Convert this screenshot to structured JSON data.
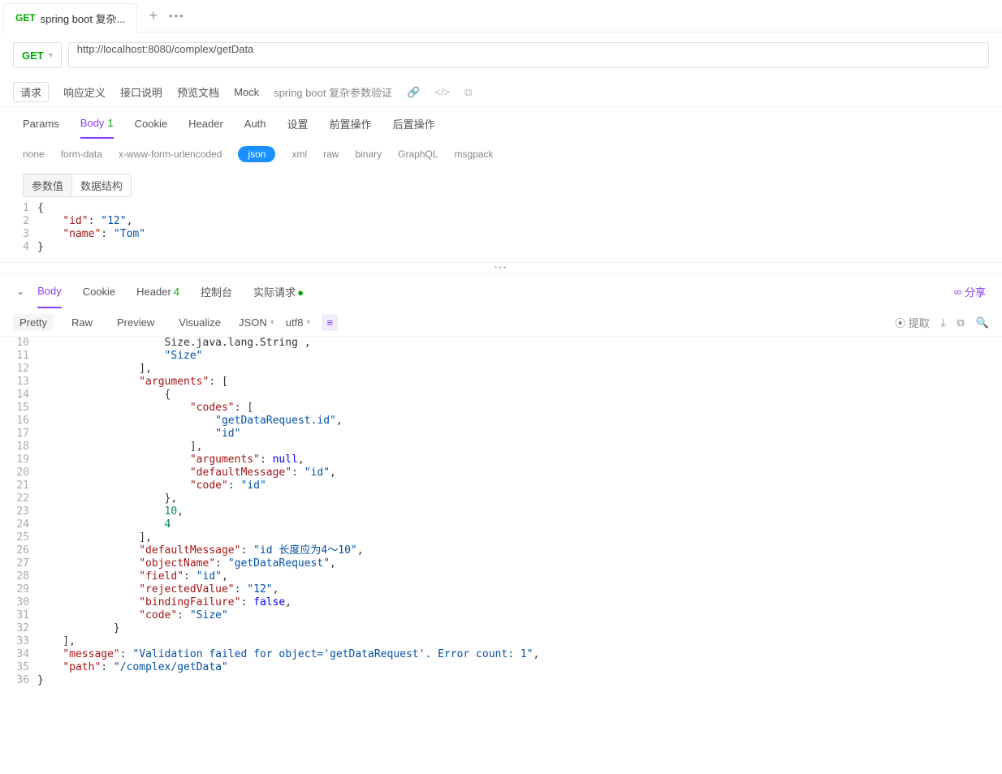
{
  "topTab": {
    "method": "GET",
    "title": "spring boot 复杂..."
  },
  "method": "GET",
  "url": "http://localhost:8080/complex/getData",
  "subTabs": {
    "req": "请求",
    "respDef": "响应定义",
    "ifaceDesc": "接口说明",
    "preview": "预览文档",
    "mock": "Mock",
    "crumb": "spring boot 复杂参数验证"
  },
  "reqTabs": {
    "params": "Params",
    "body": "Body",
    "bodyBadge": "1",
    "cookie": "Cookie",
    "header": "Header",
    "auth": "Auth",
    "settings": "设置",
    "pre": "前置操作",
    "post": "后置操作"
  },
  "bodyTypes": {
    "none": "none",
    "form": "form-data",
    "urlenc": "x-www-form-urlencoded",
    "json": "json",
    "xml": "xml",
    "raw": "raw",
    "binary": "binary",
    "graphql": "GraphQL",
    "msgpack": "msgpack"
  },
  "seg": {
    "val": "参数值",
    "struct": "数据结构"
  },
  "reqBody": {
    "lines": [
      "1",
      "2",
      "3",
      "4"
    ],
    "code": [
      [
        {
          "t": "p",
          "v": "{"
        }
      ],
      [
        {
          "t": "p",
          "v": "    "
        },
        {
          "t": "k",
          "v": "\"id\""
        },
        {
          "t": "p",
          "v": ": "
        },
        {
          "t": "s",
          "v": "\"12\""
        },
        {
          "t": "p",
          "v": ","
        }
      ],
      [
        {
          "t": "p",
          "v": "    "
        },
        {
          "t": "k",
          "v": "\"name\""
        },
        {
          "t": "p",
          "v": ": "
        },
        {
          "t": "s",
          "v": "\"Tom\""
        }
      ],
      [
        {
          "t": "p",
          "v": "}"
        }
      ]
    ]
  },
  "respTabs": {
    "body": "Body",
    "cookie": "Cookie",
    "header": "Header",
    "headerBadge": "4",
    "console": "控制台",
    "realReq": "实际请求",
    "share": "分享"
  },
  "respTools": {
    "pretty": "Pretty",
    "raw": "Raw",
    "preview": "Preview",
    "visualize": "Visualize",
    "fmt": "JSON",
    "enc": "utf8",
    "extract": "提取"
  },
  "respBody": {
    "lines": [
      "10",
      "11",
      "12",
      "13",
      "14",
      "15",
      "16",
      "17",
      "18",
      "19",
      "20",
      "21",
      "22",
      "23",
      "24",
      "25",
      "26",
      "27",
      "28",
      "29",
      "30",
      "31",
      "32",
      "33",
      "34",
      "35",
      "36"
    ],
    "code": [
      [
        {
          "t": "p",
          "v": "                    Size.java.lang.String ,"
        }
      ],
      [
        {
          "t": "p",
          "v": "                    "
        },
        {
          "t": "s",
          "v": "\"Size\""
        }
      ],
      [
        {
          "t": "p",
          "v": "                ],"
        }
      ],
      [
        {
          "t": "p",
          "v": "                "
        },
        {
          "t": "k",
          "v": "\"arguments\""
        },
        {
          "t": "p",
          "v": ": ["
        }
      ],
      [
        {
          "t": "p",
          "v": "                    {"
        }
      ],
      [
        {
          "t": "p",
          "v": "                        "
        },
        {
          "t": "k",
          "v": "\"codes\""
        },
        {
          "t": "p",
          "v": ": ["
        }
      ],
      [
        {
          "t": "p",
          "v": "                            "
        },
        {
          "t": "s",
          "v": "\"getDataRequest.id\""
        },
        {
          "t": "p",
          "v": ","
        }
      ],
      [
        {
          "t": "p",
          "v": "                            "
        },
        {
          "t": "s",
          "v": "\"id\""
        }
      ],
      [
        {
          "t": "p",
          "v": "                        ],"
        }
      ],
      [
        {
          "t": "p",
          "v": "                        "
        },
        {
          "t": "k",
          "v": "\"arguments\""
        },
        {
          "t": "p",
          "v": ": "
        },
        {
          "t": "b",
          "v": "null"
        },
        {
          "t": "p",
          "v": ","
        }
      ],
      [
        {
          "t": "p",
          "v": "                        "
        },
        {
          "t": "k",
          "v": "\"defaultMessage\""
        },
        {
          "t": "p",
          "v": ": "
        },
        {
          "t": "s",
          "v": "\"id\""
        },
        {
          "t": "p",
          "v": ","
        }
      ],
      [
        {
          "t": "p",
          "v": "                        "
        },
        {
          "t": "k",
          "v": "\"code\""
        },
        {
          "t": "p",
          "v": ": "
        },
        {
          "t": "s",
          "v": "\"id\""
        }
      ],
      [
        {
          "t": "p",
          "v": "                    },"
        }
      ],
      [
        {
          "t": "p",
          "v": "                    "
        },
        {
          "t": "n",
          "v": "10"
        },
        {
          "t": "p",
          "v": ","
        }
      ],
      [
        {
          "t": "p",
          "v": "                    "
        },
        {
          "t": "n",
          "v": "4"
        }
      ],
      [
        {
          "t": "p",
          "v": "                ],"
        }
      ],
      [
        {
          "t": "p",
          "v": "                "
        },
        {
          "t": "k",
          "v": "\"defaultMessage\""
        },
        {
          "t": "p",
          "v": ": "
        },
        {
          "t": "s",
          "v": "\"id 长度应为4～10\""
        },
        {
          "t": "p",
          "v": ","
        }
      ],
      [
        {
          "t": "p",
          "v": "                "
        },
        {
          "t": "k",
          "v": "\"objectName\""
        },
        {
          "t": "p",
          "v": ": "
        },
        {
          "t": "s",
          "v": "\"getDataRequest\""
        },
        {
          "t": "p",
          "v": ","
        }
      ],
      [
        {
          "t": "p",
          "v": "                "
        },
        {
          "t": "k",
          "v": "\"field\""
        },
        {
          "t": "p",
          "v": ": "
        },
        {
          "t": "s",
          "v": "\"id\""
        },
        {
          "t": "p",
          "v": ","
        }
      ],
      [
        {
          "t": "p",
          "v": "                "
        },
        {
          "t": "k",
          "v": "\"rejectedValue\""
        },
        {
          "t": "p",
          "v": ": "
        },
        {
          "t": "s",
          "v": "\"12\""
        },
        {
          "t": "p",
          "v": ","
        }
      ],
      [
        {
          "t": "p",
          "v": "                "
        },
        {
          "t": "k",
          "v": "\"bindingFailure\""
        },
        {
          "t": "p",
          "v": ": "
        },
        {
          "t": "b",
          "v": "false"
        },
        {
          "t": "p",
          "v": ","
        }
      ],
      [
        {
          "t": "p",
          "v": "                "
        },
        {
          "t": "k",
          "v": "\"code\""
        },
        {
          "t": "p",
          "v": ": "
        },
        {
          "t": "s",
          "v": "\"Size\""
        }
      ],
      [
        {
          "t": "p",
          "v": "            }"
        }
      ],
      [
        {
          "t": "p",
          "v": "    ],"
        }
      ],
      [
        {
          "t": "p",
          "v": "    "
        },
        {
          "t": "k",
          "v": "\"message\""
        },
        {
          "t": "p",
          "v": ": "
        },
        {
          "t": "s",
          "v": "\"Validation failed for object='getDataRequest'. Error count: 1\""
        },
        {
          "t": "p",
          "v": ","
        }
      ],
      [
        {
          "t": "p",
          "v": "    "
        },
        {
          "t": "k",
          "v": "\"path\""
        },
        {
          "t": "p",
          "v": ": "
        },
        {
          "t": "s",
          "v": "\"/complex/getData\""
        }
      ],
      [
        {
          "t": "p",
          "v": "}"
        }
      ]
    ]
  }
}
